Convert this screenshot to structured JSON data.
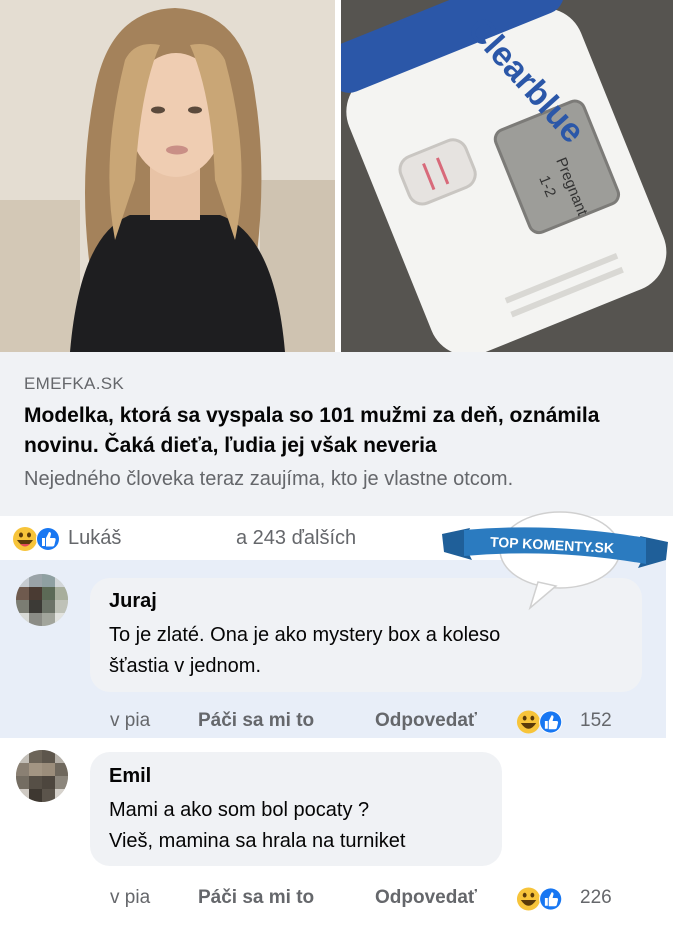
{
  "post": {
    "domain": "EMEFKA.SK",
    "headline": "Modelka, ktorá sa vyspala so 101 mužmi za deň, oznámila novinu. Čaká dieťa, ľudia jej však neveria",
    "description": "Nejedného človeka teraz zaujíma, kto je vlastne otcom."
  },
  "reactions": {
    "icons": [
      "haha-icon",
      "like-icon"
    ],
    "name": "Lukáš",
    "others": "a 243 ďalších"
  },
  "badge": {
    "text": "TOP KOMENTY.SK"
  },
  "comments": [
    {
      "author": "Juraj",
      "lines": [
        "To je zlaté. Ona je ako mystery box a koleso",
        "šťastia v jednom."
      ],
      "time": "v pia",
      "like_label": "Páči sa mi to",
      "reply_label": "Odpovedať",
      "reaction_count": "152"
    },
    {
      "author": "Emil",
      "lines": [
        "Mami a ako som bol pocaty ?",
        "Vieš, mamina sa hrala na turniket"
      ],
      "time": "v pia",
      "like_label": "Páči sa mi to",
      "reply_label": "Odpovedať",
      "reaction_count": "226"
    }
  ],
  "test_image": {
    "brand": "Clearblue",
    "screen_line1": "Pregnant",
    "screen_line2": "1-2"
  },
  "colors": {
    "accent_blue": "#1877f2",
    "badge_blue": "#2b7bc0",
    "haha_yellow": "#f7c43a"
  }
}
